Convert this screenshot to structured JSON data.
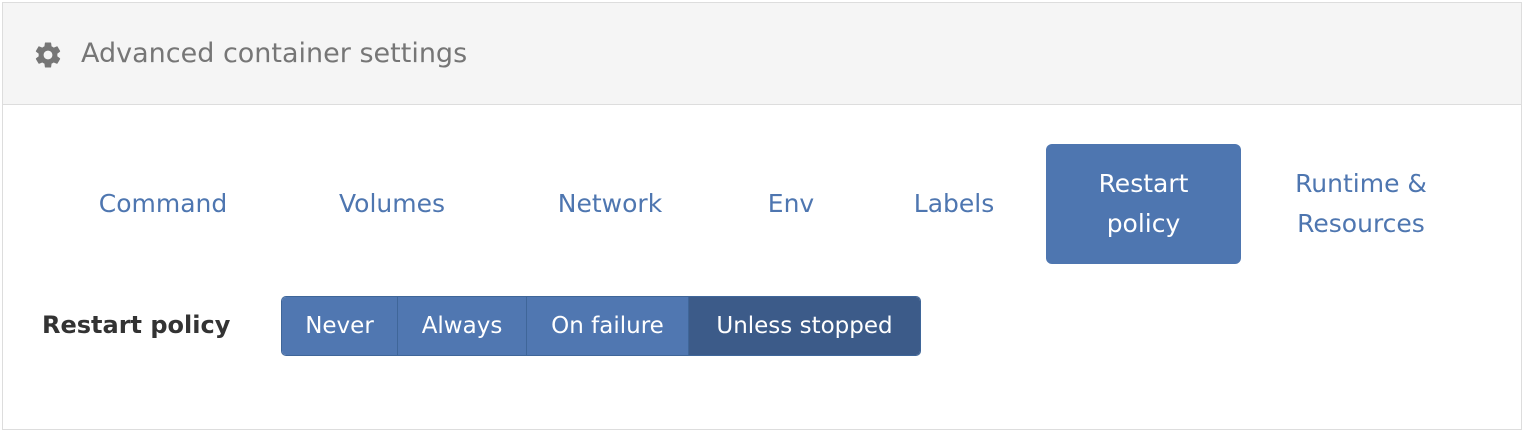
{
  "panel": {
    "title": "Advanced container settings",
    "icon": "gear-icon"
  },
  "tabs": [
    {
      "label": "Command",
      "active": false
    },
    {
      "label": "Volumes",
      "active": false
    },
    {
      "label": "Network",
      "active": false
    },
    {
      "label": "Env",
      "active": false
    },
    {
      "label": "Labels",
      "active": false
    },
    {
      "label": "Restart\npolicy",
      "active": true
    },
    {
      "label": "Runtime &\nResources",
      "active": false
    }
  ],
  "restart_policy": {
    "label": "Restart policy",
    "options": [
      "Never",
      "Always",
      "On failure",
      "Unless stopped"
    ],
    "selected": "Unless stopped"
  },
  "colors": {
    "accent": "#4e76b0",
    "selected": "#3c5b89",
    "header_bg": "#f5f5f5"
  }
}
